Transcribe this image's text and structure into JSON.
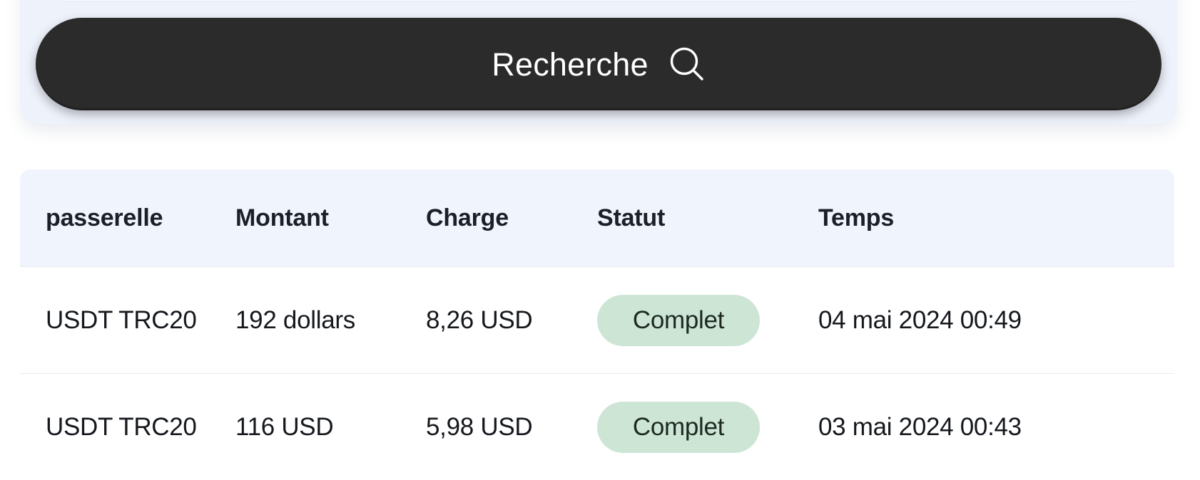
{
  "search": {
    "input_value": "",
    "input_placeholder": "",
    "button_label": "Recherche",
    "button_icon": "search-icon",
    "button_bg": "#2b2b2b",
    "card_bg": "#eef2fb"
  },
  "table": {
    "header_bg": "#f0f4fd",
    "columns": [
      {
        "key": "gateway",
        "label": "passerelle"
      },
      {
        "key": "amount",
        "label": "Montant"
      },
      {
        "key": "charge",
        "label": "Charge"
      },
      {
        "key": "status",
        "label": "Statut"
      },
      {
        "key": "time",
        "label": "Temps"
      }
    ],
    "status_colors": {
      "complete_bg": "#cde5d5",
      "complete_text": "#1d2a22"
    },
    "time_color": "#8b96a8",
    "rows": [
      {
        "gateway": "USDT TRC20",
        "amount": "192 dollars",
        "charge": "8,26 USD",
        "status": "Complet",
        "time": "04 mai 2024 00:49"
      },
      {
        "gateway": "USDT TRC20",
        "amount": "116 USD",
        "charge": "5,98 USD",
        "status": "Complet",
        "time": "03 mai 2024 00:43"
      }
    ]
  }
}
